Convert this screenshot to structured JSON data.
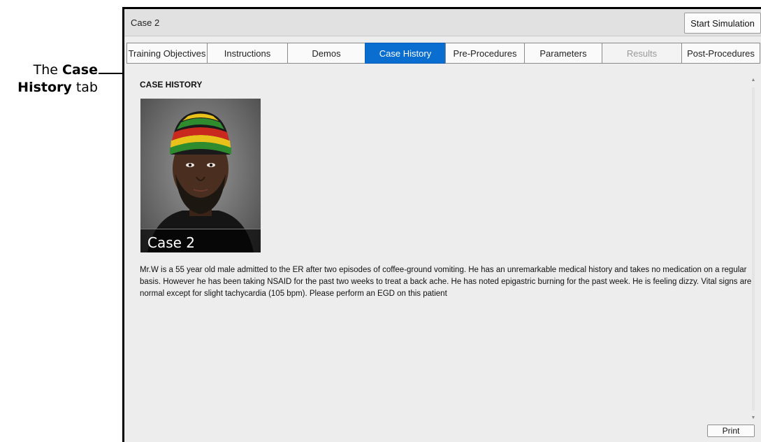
{
  "callout": {
    "prefix": "The ",
    "bold1": "Case",
    "bold2": "History",
    "suffix": " tab"
  },
  "window": {
    "title": "Case 2",
    "start_button": "Start Simulation"
  },
  "tabs": [
    {
      "label": "Training Objectives",
      "state": "normal"
    },
    {
      "label": "Instructions",
      "state": "normal"
    },
    {
      "label": "Demos",
      "state": "normal"
    },
    {
      "label": "Case History",
      "state": "active"
    },
    {
      "label": "Pre-Procedures",
      "state": "normal"
    },
    {
      "label": "Parameters",
      "state": "normal"
    },
    {
      "label": "Results",
      "state": "disabled"
    },
    {
      "label": "Post-Procedures",
      "state": "normal"
    }
  ],
  "content": {
    "section_title": "CASE HISTORY",
    "photo_caption": "Case 2",
    "history": "Mr.W is a 55 year old male admitted to the ER after two episodes of coffee-ground vomiting. He has an unremarkable medical history and takes no medication on a regular basis. However he has been taking NSAID for the past two weeks to treat a back ache. He has noted epigastric burning for the past week. He is feeling dizzy. Vital signs are normal except for slight tachycardia (105 bpm). Please perform an EGD on this patient",
    "print_button": "Print"
  },
  "colors": {
    "active_tab": "#0a6ed1",
    "window_bg": "#ededed"
  }
}
